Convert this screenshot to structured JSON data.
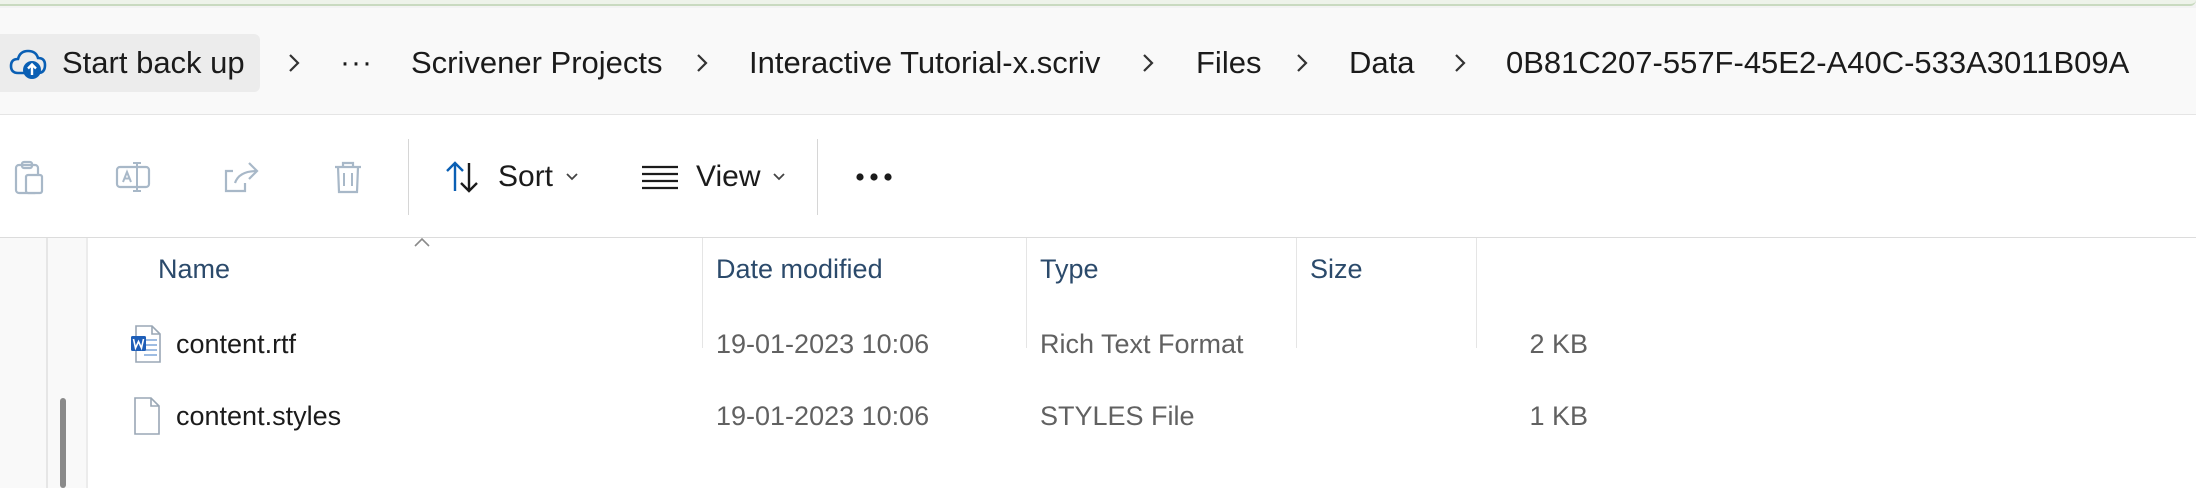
{
  "breadcrumb": {
    "items": [
      {
        "label": "Start back up"
      },
      {
        "label": "Scrivener Projects"
      },
      {
        "label": "Interactive Tutorial-x.scriv"
      },
      {
        "label": "Files"
      },
      {
        "label": "Data"
      },
      {
        "label": "0B81C207-557F-45E2-A40C-533A3011B09A"
      }
    ],
    "overflow_label": "···",
    "cloud_icon": "cloud-upload-icon",
    "separator_icon": "chevron-right-icon"
  },
  "toolbar": {
    "paste_icon": "paste-icon",
    "rename_icon": "rename-icon",
    "share_icon": "share-icon",
    "delete_icon": "trash-icon",
    "sort_label": "Sort",
    "view_label": "View",
    "more_icon": "more-horizontal-icon"
  },
  "file_list": {
    "columns": [
      {
        "label": "Name"
      },
      {
        "label": "Date modified"
      },
      {
        "label": "Type"
      },
      {
        "label": "Size"
      }
    ],
    "rows": [
      {
        "name": "content.rtf",
        "date": "19-01-2023 10:06",
        "type": "Rich Text Format",
        "size": "2 KB",
        "icon": "word-document-icon"
      },
      {
        "name": "content.styles",
        "date": "19-01-2023 10:06",
        "type": "STYLES File",
        "size": "1 KB",
        "icon": "blank-file-icon"
      }
    ]
  },
  "colors": {
    "accent": "#0067c0",
    "header_text": "#2b4a6b",
    "secondary_text": "#616161"
  }
}
